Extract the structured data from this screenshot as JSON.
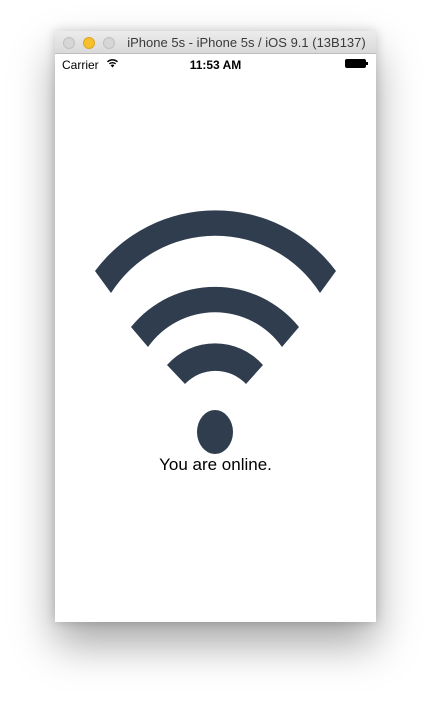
{
  "window": {
    "title": "iPhone 5s - iPhone 5s / iOS 9.1 (13B137)"
  },
  "statusbar": {
    "carrier": "Carrier",
    "time": "11:53 AM",
    "wifi_icon": "wifi-icon",
    "battery_icon": "battery-icon"
  },
  "main": {
    "icon": "wifi-icon",
    "icon_color": "#2f3d4f",
    "message": "You are online."
  }
}
